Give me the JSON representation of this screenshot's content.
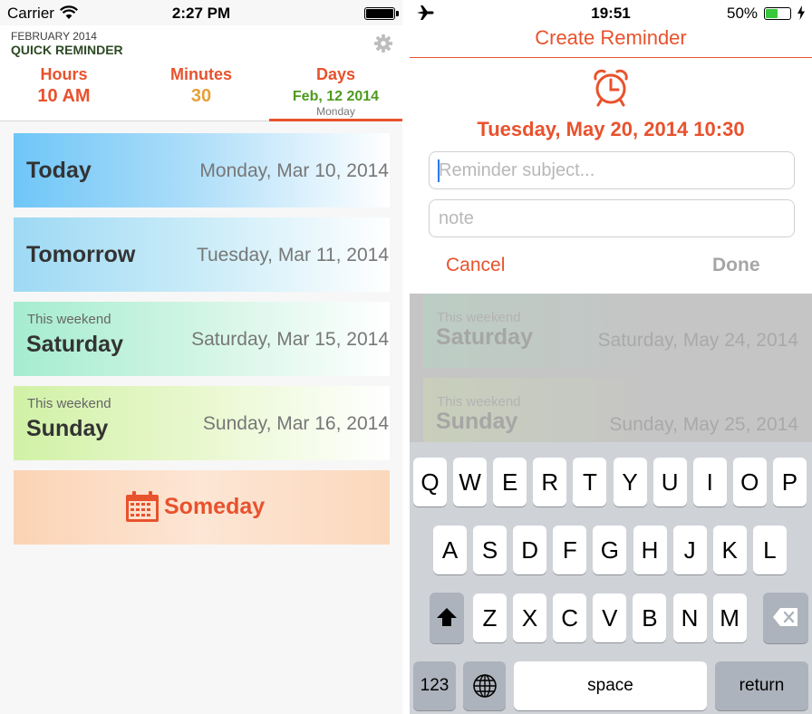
{
  "left": {
    "status": {
      "carrier": "Carrier",
      "time": "2:27 PM"
    },
    "header": {
      "month": "FEBRUARY 2014",
      "app_name": "QUICK REMINDER"
    },
    "segments": {
      "hours": {
        "label": "Hours",
        "value": "10 AM"
      },
      "minutes": {
        "label": "Minutes",
        "value": "30"
      },
      "days": {
        "label": "Days",
        "value": "Feb, 12 2014",
        "sub": "Monday"
      }
    },
    "cards": [
      {
        "prefix": "",
        "name": "Today",
        "date": "Monday, Mar 10, 2014"
      },
      {
        "prefix": "",
        "name": "Tomorrow",
        "date": "Tuesday, Mar 11, 2014"
      },
      {
        "prefix": "This weekend",
        "name": "Saturday",
        "date": "Saturday, Mar 15, 2014"
      },
      {
        "prefix": "This weekend",
        "name": "Sunday",
        "date": "Sunday, Mar 16, 2014"
      }
    ],
    "someday": {
      "label": "Someday"
    },
    "colors": {
      "accent": "#e8522d",
      "brand_dark": "#2e4a24",
      "days_green": "#4e9a1f",
      "minutes_orange": "#e4a13a"
    }
  },
  "right": {
    "status": {
      "time": "19:51",
      "battery": "50%"
    },
    "title": "Create Reminder",
    "date": "Tuesday, May 20, 2014 10:30",
    "subject_placeholder": "Reminder subject...",
    "note_placeholder": "note",
    "cancel_label": "Cancel",
    "done_label": "Done",
    "background_cards": [
      {
        "prefix": "This weekend",
        "name": "Saturday",
        "date": "Saturday, May 24, 2014"
      },
      {
        "prefix": "This weekend",
        "name": "Sunday",
        "date": "Sunday, May 25, 2014"
      }
    ],
    "keyboard": {
      "row1": [
        "Q",
        "W",
        "E",
        "R",
        "T",
        "Y",
        "U",
        "I",
        "O",
        "P"
      ],
      "row2": [
        "A",
        "S",
        "D",
        "F",
        "G",
        "H",
        "J",
        "K",
        "L"
      ],
      "row3": [
        "Z",
        "X",
        "C",
        "V",
        "B",
        "N",
        "M"
      ],
      "numbers_label": "123",
      "space_label": "space",
      "return_label": "return",
      "icons": {
        "shift": "shift-icon",
        "backspace": "backspace-icon",
        "globe": "globe-icon"
      }
    }
  }
}
